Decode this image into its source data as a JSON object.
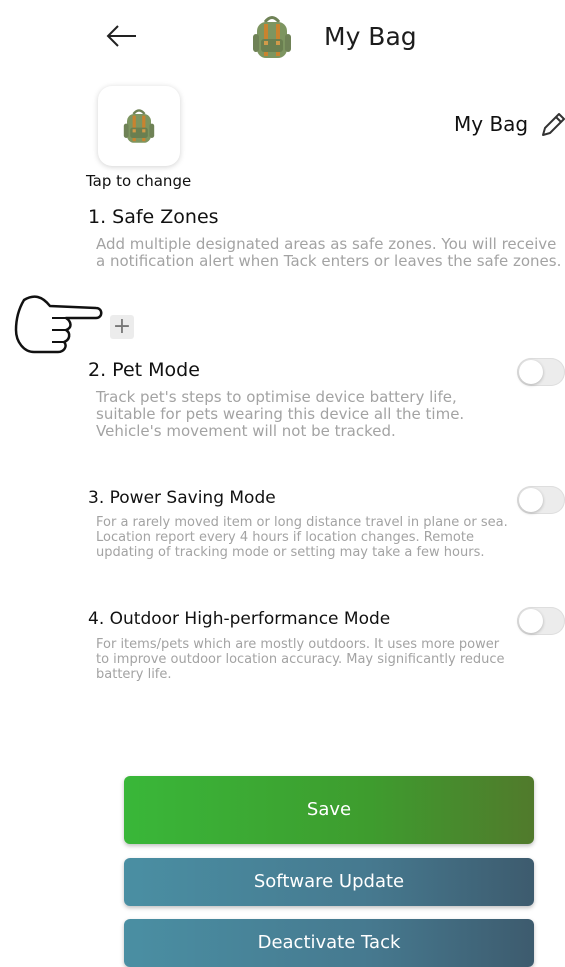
{
  "header": {
    "back_icon": "arrow-left-icon",
    "bag_icon": "backpack-icon",
    "title": "My Bag"
  },
  "profile": {
    "icon": "backpack-icon",
    "tap_to_change": "Tap to change",
    "name": "My Bag",
    "edit_icon": "pencil-icon"
  },
  "sections": {
    "safe_zones": {
      "title": "1. Safe Zones",
      "desc": "Add multiple designated areas as safe zones. You will receive a notification alert when Tack enters or leaves the safe zones.",
      "add_icon": "plus-icon",
      "pointer_icon": "pointing-hand-icon"
    },
    "pet_mode": {
      "title": "2. Pet Mode",
      "desc": "Track pet's steps to optimise device battery life, suitable for pets wearing this device all the time. Vehicle's movement will not be tracked.",
      "enabled": false
    },
    "power_saving": {
      "title": "3. Power Saving Mode",
      "desc": "For a rarely moved item or long distance travel in plane or sea. Location report every 4 hours if location changes. Remote updating of tracking mode or setting may take a few hours.",
      "enabled": false
    },
    "outdoor": {
      "title": "4. Outdoor High-performance Mode",
      "desc": "For items/pets which are mostly outdoors. It uses more power to improve outdoor location accuracy. May significantly reduce battery life.",
      "enabled": false
    }
  },
  "buttons": {
    "save": "Save",
    "software_update": "Software Update",
    "deactivate": "Deactivate Tack"
  },
  "colors": {
    "save_green": "#3e9c2e",
    "action_teal": "#46798f",
    "desc_gray": "#a3a3a3"
  }
}
